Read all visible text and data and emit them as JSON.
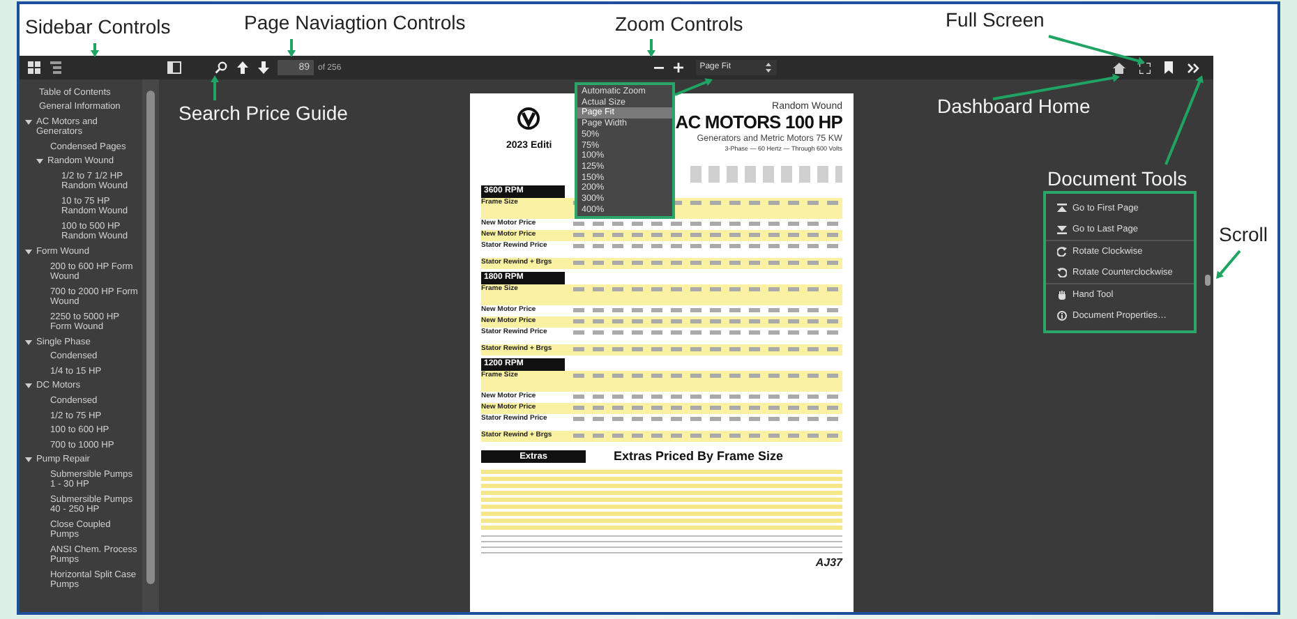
{
  "annotations": [
    {
      "label": "Sidebar Controls"
    },
    {
      "label": "Page Naviagtion Controls"
    },
    {
      "label": "Zoom Controls"
    },
    {
      "label": "Full Screen"
    },
    {
      "label": "Search Price Guide"
    },
    {
      "label": "Dashboard Home"
    },
    {
      "label": "Document Tools"
    },
    {
      "label": "Scroll"
    }
  ],
  "sidebar": {
    "items": [
      {
        "label": "Table of Contents"
      },
      {
        "label": "General Information"
      },
      {
        "label": "AC Motors and Generators",
        "expanded": true,
        "children": [
          {
            "label": "Condensed Pages"
          },
          {
            "label": "Random Wound",
            "expanded": true,
            "children": [
              {
                "label": "1/2 to 7 1/2 HP Random Wound"
              },
              {
                "label": "10 to 75 HP Random Wound"
              },
              {
                "label": "100 to 500 HP Random Wound"
              }
            ]
          }
        ]
      },
      {
        "label": "Form Wound",
        "expanded": true,
        "children": [
          {
            "label": "200 to 600 HP Form Wound"
          },
          {
            "label": "700 to 2000 HP Form Wound"
          },
          {
            "label": "2250 to 5000 HP Form Wound"
          }
        ]
      },
      {
        "label": "Single Phase",
        "expanded": true,
        "children": [
          {
            "label": "Condensed"
          },
          {
            "label": "1/4 to 15 HP"
          }
        ]
      },
      {
        "label": "DC Motors",
        "expanded": true,
        "children": [
          {
            "label": "Condensed"
          },
          {
            "label": "1/2 to 75 HP"
          },
          {
            "label": "100 to 600 HP"
          },
          {
            "label": "700 to 1000 HP"
          }
        ]
      },
      {
        "label": "Pump Repair",
        "expanded": true,
        "children": [
          {
            "label": "Submersible Pumps 1 - 30 HP"
          },
          {
            "label": "Submersible Pumps 40 - 250 HP"
          },
          {
            "label": "Close Coupled Pumps"
          },
          {
            "label": "ANSI Chem. Process Pumps"
          },
          {
            "label": "Horizontal Split Case Pumps"
          }
        ]
      }
    ]
  },
  "toolbar": {
    "page_input": "89",
    "page_count": "of 256",
    "zoom_select": "Page Fit"
  },
  "zoom_menu": {
    "options": [
      {
        "label": "Automatic Zoom",
        "selected": false
      },
      {
        "label": "Actual Size",
        "selected": false
      },
      {
        "label": "Page Fit",
        "selected": true
      },
      {
        "label": "Page Width",
        "selected": false
      },
      {
        "label": "50%",
        "selected": false
      },
      {
        "label": "75%",
        "selected": false
      },
      {
        "label": "100%",
        "selected": false
      },
      {
        "label": "125%",
        "selected": false
      },
      {
        "label": "150%",
        "selected": false
      },
      {
        "label": "200%",
        "selected": false
      },
      {
        "label": "300%",
        "selected": false
      },
      {
        "label": "400%",
        "selected": false
      }
    ]
  },
  "document_tools": {
    "items": [
      {
        "label": "Go to First Page",
        "kind": "first"
      },
      {
        "label": "Go to Last Page",
        "kind": "last"
      },
      {
        "label": "Rotate Clockwise",
        "kind": "cw"
      },
      {
        "label": "Rotate Counterclockwise",
        "kind": "ccw"
      },
      {
        "label": "Hand Tool",
        "kind": "hand"
      },
      {
        "label": "Document Properties…",
        "kind": "info"
      }
    ]
  },
  "document": {
    "header": {
      "category": "Random Wound",
      "title": "AC MOTORS 100 HP",
      "subtitle": "Generators and Metric Motors 75 KW",
      "specs": "3-Phase — 60 Hertz — Through 600 Volts",
      "edition": "2023 Editi"
    },
    "sections": [
      {
        "title": "3600 RPM",
        "rows": [
          {
            "label": "Frame Size",
            "highlighted": true
          },
          {
            "label": "New Motor Price",
            "highlighted": false
          },
          {
            "label": "New Motor Price",
            "highlighted": true
          },
          {
            "label": "Stator Rewind Price",
            "highlighted": false
          },
          {
            "label": "Stator Rewind + Brgs",
            "highlighted": true
          }
        ]
      },
      {
        "title": "1800 RPM",
        "rows": [
          {
            "label": "Frame Size",
            "highlighted": true
          },
          {
            "label": "New Motor Price",
            "highlighted": false
          },
          {
            "label": "New Motor Price",
            "highlighted": true
          },
          {
            "label": "Stator Rewind Price",
            "highlighted": false
          },
          {
            "label": "Stator Rewind + Brgs",
            "highlighted": true
          }
        ]
      },
      {
        "title": "1200 RPM",
        "rows": [
          {
            "label": "Frame Size",
            "highlighted": true
          },
          {
            "label": "New Motor Price",
            "highlighted": false
          },
          {
            "label": "New Motor Price",
            "highlighted": true
          },
          {
            "label": "Stator Rewind Price",
            "highlighted": false
          },
          {
            "label": "Stator Rewind + Brgs",
            "highlighted": true
          }
        ]
      }
    ],
    "extras": {
      "title": "Extras",
      "heading": "Extras Priced By Frame Size"
    },
    "page_number": "AJ37"
  }
}
